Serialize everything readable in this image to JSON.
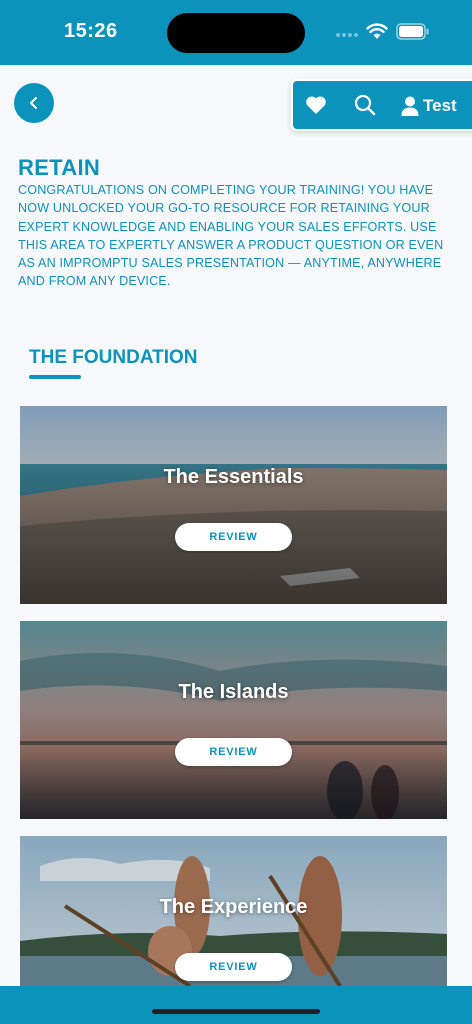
{
  "status": {
    "time": "15:26"
  },
  "header": {
    "user_name": "Test"
  },
  "retain": {
    "title": "RETAIN",
    "description": "CONGRATULATIONS ON COMPLETING YOUR TRAINING! YOU HAVE NOW UNLOCKED YOUR GO-TO RESOURCE FOR RETAINING YOUR EXPERT KNOWLEDGE AND ENABLING YOUR SALES EFFORTS. USE THIS AREA TO EXPERTLY ANSWER A PRODUCT QUESTION OR EVEN AS AN IMPROMPTU SALES PRESENTATION — ANYTIME, ANYWHERE AND FROM ANY DEVICE."
  },
  "section": {
    "title": "THE FOUNDATION"
  },
  "cards": [
    {
      "title": "The Essentials",
      "button": "REVIEW"
    },
    {
      "title": "The Islands",
      "button": "REVIEW"
    },
    {
      "title": "The Experience",
      "button": "REVIEW"
    }
  ],
  "colors": {
    "accent": "#0c93bc",
    "background": "#f6f8fb"
  },
  "icons": [
    "back-chevron-icon",
    "heart-icon",
    "search-icon",
    "user-icon",
    "wifi-icon",
    "battery-icon"
  ]
}
